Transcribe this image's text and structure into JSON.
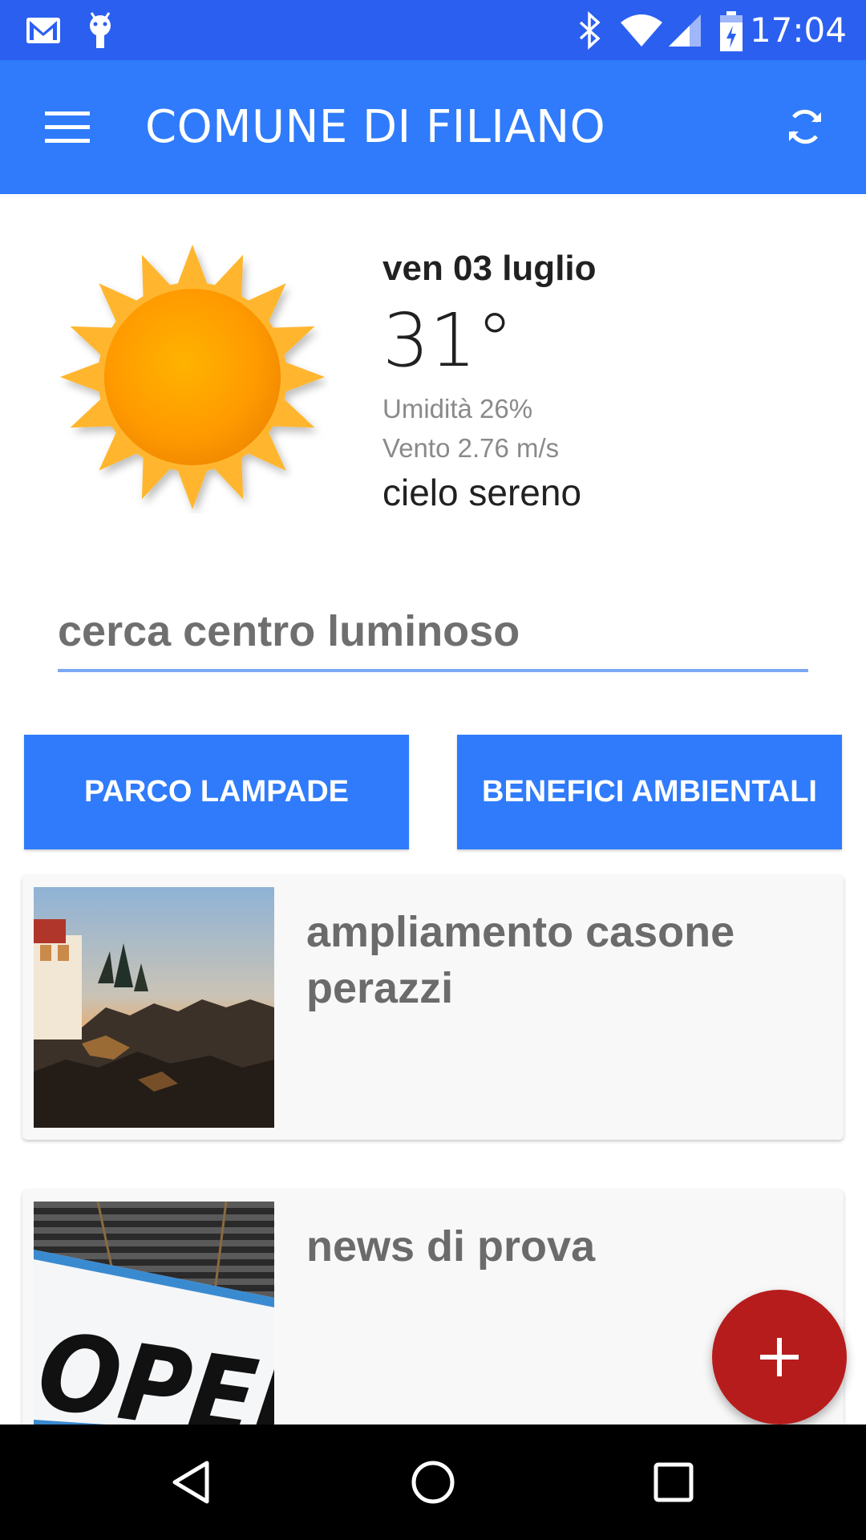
{
  "status_bar": {
    "time": "17:04",
    "icons": [
      "gmail-icon",
      "android-icon",
      "bluetooth-icon",
      "wifi-icon",
      "signal-icon",
      "battery-icon"
    ]
  },
  "app_bar": {
    "title": "COMUNE DI FILIANO",
    "menu_icon": "hamburger-menu-icon",
    "refresh_icon": "refresh-icon"
  },
  "weather": {
    "icon": "sun-icon",
    "date": "ven 03 luglio",
    "temperature": "31°",
    "humidity": "Umidità 26%",
    "wind": "Vento 2.76 m/s",
    "description": "cielo sereno"
  },
  "search": {
    "placeholder": "cerca centro luminoso",
    "value": ""
  },
  "buttons": {
    "left_label": "PARCO LAMPADE",
    "right_label": "BENEFICI AMBIENTALI"
  },
  "news": [
    {
      "title": "ampliamento casone perazzi",
      "image": "lighthouse-sunset"
    },
    {
      "title": "news di prova",
      "image": "open-sign"
    }
  ],
  "fab": {
    "icon": "plus-icon"
  },
  "nav": [
    "back-icon",
    "home-icon",
    "recents-icon"
  ],
  "colors": {
    "status_bar": "#2b5ff0",
    "app_bar": "#2f7bfb",
    "accent": "#2f7bfb",
    "fab": "#b71c1c"
  }
}
